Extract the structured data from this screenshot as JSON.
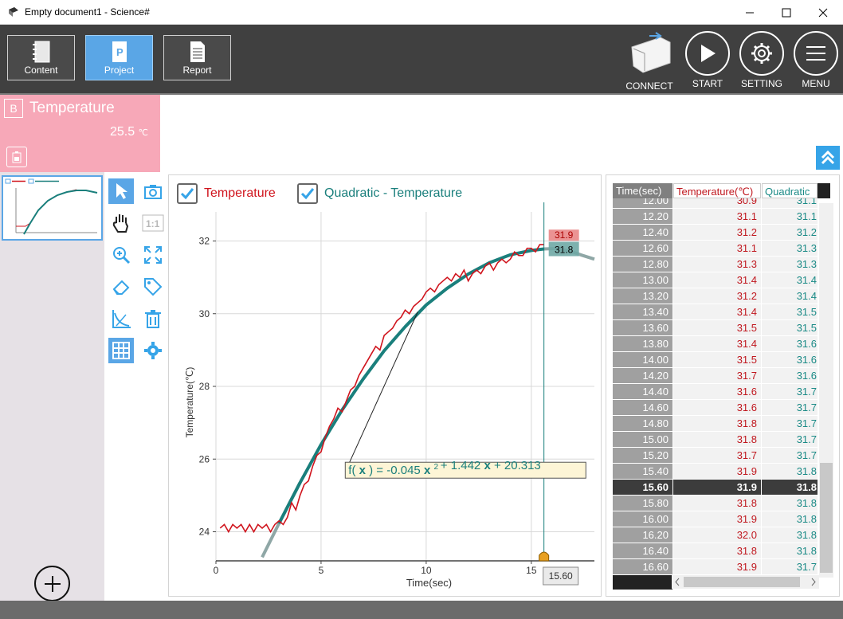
{
  "window": {
    "title": "Empty document1 - Science#",
    "minimize": "—",
    "maximize": "☐",
    "close": "✕"
  },
  "nav": {
    "content": "Content",
    "project": "Project",
    "report": "Report"
  },
  "actions": {
    "connect": "CONNECT",
    "start": "START",
    "setting": "SETTING",
    "menu": "MENU"
  },
  "sensor": {
    "badge": "B",
    "name": "Temperature",
    "value": "25.5",
    "unit": "℃"
  },
  "legend": {
    "s1": "Temperature",
    "s2": "Quadratic - Temperature"
  },
  "fit": {
    "label": "f( x ) = -0.045 x² + 1.442 x + 20.313",
    "f": "f(",
    "x1": "x",
    "eq": ") = -0.045",
    "x2": "x",
    "sup": "2",
    "b": "+ 1.442",
    "x3": "x",
    "c": "+ 20.313"
  },
  "cursor": {
    "x_label": "15.60",
    "tooltip_hidden": "31.9",
    "tooltip_value": "31.8"
  },
  "chart_data": {
    "type": "line",
    "xlabel": "Time(sec)",
    "ylabel": "Temperature(℃)",
    "xlim": [
      0,
      18
    ],
    "ylim": [
      23.2,
      32.8
    ],
    "x_ticks": [
      "0",
      "5",
      "10",
      "15"
    ],
    "y_ticks": [
      "24",
      "26",
      "28",
      "30",
      "32"
    ],
    "series": [
      {
        "name": "Temperature",
        "color": "#d0141d",
        "x": [
          0.2,
          0.4,
          0.6,
          0.8,
          1.0,
          1.2,
          1.4,
          1.6,
          1.8,
          2.0,
          2.2,
          2.4,
          2.6,
          2.8,
          3.0,
          3.2,
          3.4,
          3.6,
          3.8,
          4.0,
          4.2,
          4.4,
          4.6,
          4.8,
          5.0,
          5.2,
          5.4,
          5.6,
          5.8,
          6.0,
          6.2,
          6.4,
          6.6,
          6.8,
          7.0,
          7.2,
          7.4,
          7.6,
          7.8,
          8.0,
          8.2,
          8.4,
          8.6,
          8.8,
          9.0,
          9.2,
          9.4,
          9.6,
          9.8,
          10.0,
          10.2,
          10.4,
          10.6,
          10.8,
          11.0,
          11.2,
          11.4,
          11.6,
          11.8,
          12.0,
          12.2,
          12.4,
          12.6,
          12.8,
          13.0,
          13.2,
          13.4,
          13.6,
          13.8,
          14.0,
          14.2,
          14.4,
          14.6,
          14.8,
          15.0,
          15.2,
          15.4,
          15.6
        ],
        "y": [
          24.1,
          24.2,
          24.0,
          24.2,
          24.1,
          24.2,
          24.0,
          24.2,
          24.0,
          24.2,
          24.1,
          24.2,
          24.0,
          24.2,
          24.3,
          24.2,
          24.4,
          24.8,
          24.6,
          25.0,
          25.3,
          25.4,
          25.8,
          26.1,
          26.2,
          26.6,
          26.9,
          27.1,
          27.4,
          27.3,
          27.6,
          27.9,
          28.0,
          28.3,
          28.5,
          28.7,
          28.9,
          29.1,
          29.0,
          29.4,
          29.5,
          29.6,
          29.8,
          29.9,
          30.1,
          30.0,
          30.2,
          30.3,
          30.4,
          30.6,
          30.7,
          30.6,
          30.8,
          30.9,
          31.0,
          30.9,
          31.1,
          31.0,
          31.2,
          30.9,
          31.1,
          31.2,
          31.1,
          31.3,
          31.4,
          31.2,
          31.4,
          31.5,
          31.4,
          31.5,
          31.7,
          31.6,
          31.6,
          31.8,
          31.8,
          31.7,
          31.9,
          31.9
        ]
      },
      {
        "name": "Quadratic - Temperature",
        "color": "#1a7f7c",
        "x": [
          2.2,
          3.0,
          4.0,
          5.0,
          6.0,
          7.0,
          8.0,
          9.0,
          10.0,
          11.0,
          12.0,
          13.0,
          14.0,
          15.0,
          15.6,
          16.0,
          16.6,
          17.0,
          17.4,
          18.0
        ],
        "y": [
          23.3,
          24.23,
          25.35,
          26.4,
          27.35,
          28.2,
          28.98,
          29.64,
          30.24,
          30.7,
          31.09,
          31.4,
          31.62,
          31.74,
          31.78,
          31.79,
          31.75,
          31.69,
          31.61,
          31.5
        ]
      }
    ]
  },
  "table": {
    "headers": [
      "Time(sec)",
      "Temperature(℃)",
      "Quadratic"
    ],
    "rows": [
      [
        "12.00",
        "30.9",
        "31.1"
      ],
      [
        "12.20",
        "31.1",
        "31.1"
      ],
      [
        "12.40",
        "31.2",
        "31.2"
      ],
      [
        "12.60",
        "31.1",
        "31.3"
      ],
      [
        "12.80",
        "31.3",
        "31.3"
      ],
      [
        "13.00",
        "31.4",
        "31.4"
      ],
      [
        "13.20",
        "31.2",
        "31.4"
      ],
      [
        "13.40",
        "31.4",
        "31.5"
      ],
      [
        "13.60",
        "31.5",
        "31.5"
      ],
      [
        "13.80",
        "31.4",
        "31.6"
      ],
      [
        "14.00",
        "31.5",
        "31.6"
      ],
      [
        "14.20",
        "31.7",
        "31.6"
      ],
      [
        "14.40",
        "31.6",
        "31.7"
      ],
      [
        "14.60",
        "31.6",
        "31.7"
      ],
      [
        "14.80",
        "31.8",
        "31.7"
      ],
      [
        "15.00",
        "31.8",
        "31.7"
      ],
      [
        "15.20",
        "31.7",
        "31.7"
      ],
      [
        "15.40",
        "31.9",
        "31.8"
      ],
      [
        "15.60",
        "31.9",
        "31.8"
      ],
      [
        "15.80",
        "31.8",
        "31.8"
      ],
      [
        "16.00",
        "31.9",
        "31.8"
      ],
      [
        "16.20",
        "32.0",
        "31.8"
      ],
      [
        "16.40",
        "31.8",
        "31.8"
      ],
      [
        "16.60",
        "31.9",
        "31.7"
      ]
    ],
    "highlight_row": 18
  },
  "colors": {
    "accent": "#5aa6e6",
    "sensor_bg": "#f7a8b8",
    "temp": "#d0141d",
    "fit": "#1a7f7c",
    "toolbar": "#404040"
  }
}
